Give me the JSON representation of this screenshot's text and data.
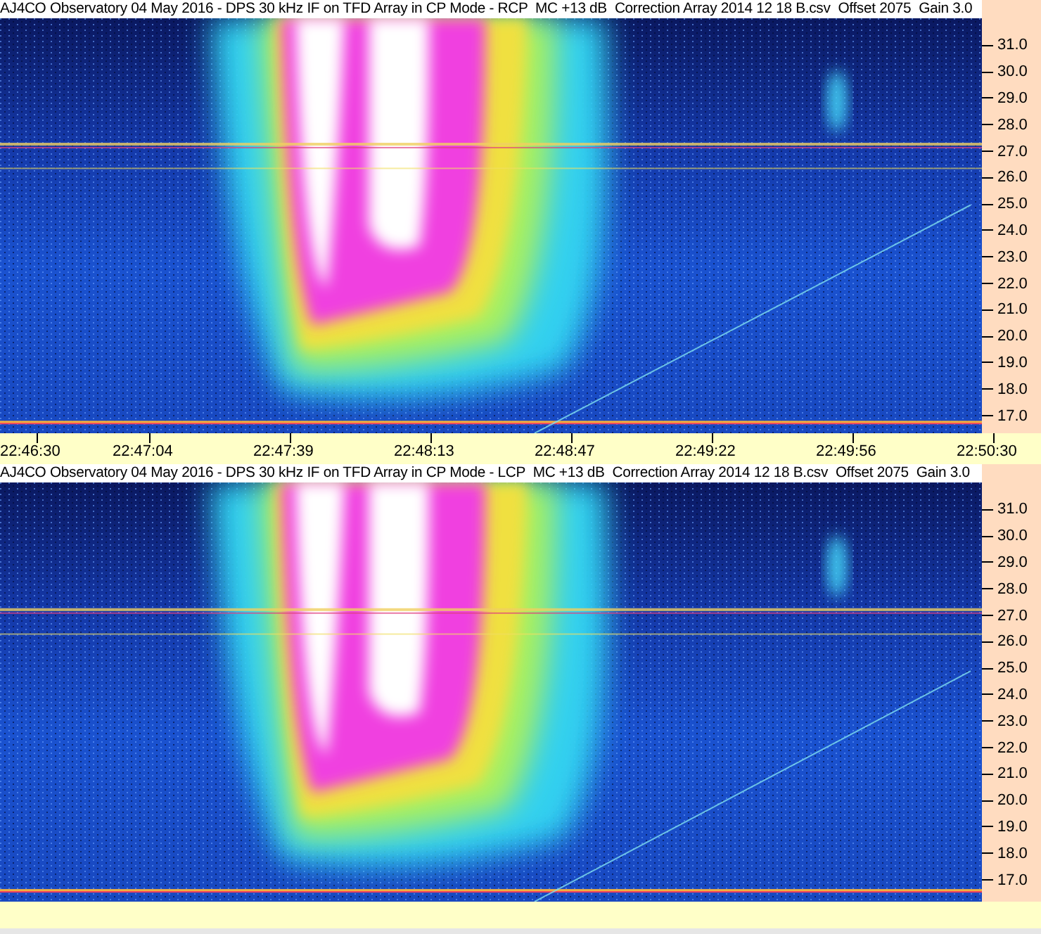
{
  "panels": [
    {
      "title": "AJ4CO Observatory 04 May 2016 - DPS 30 kHz IF on TFD Array in CP Mode - RCP  MC +13 dB  Correction Array 2014 12 18 B.csv  Offset 2075  Gain 3.0",
      "freq_ticks": [
        "31.0",
        "30.0",
        "29.0",
        "28.0",
        "27.0",
        "26.0",
        "25.0",
        "24.0",
        "23.0",
        "22.0",
        "21.0",
        "20.0",
        "19.0",
        "18.0",
        "17.0"
      ],
      "time_ticks": [
        "22:46:30",
        "22:47:04",
        "22:47:39",
        "22:48:13",
        "22:48:47",
        "22:49:22",
        "22:49:56",
        "22:50:30"
      ]
    },
    {
      "title": "AJ4CO Observatory 04 May 2016 - DPS 30 kHz IF on TFD Array in CP Mode - LCP  MC +13 dB  Correction Array 2014 12 18 B.csv  Offset 2075  Gain 3.0",
      "freq_ticks": [
        "31.0",
        "30.0",
        "29.0",
        "28.0",
        "27.0",
        "26.0",
        "25.0",
        "24.0",
        "23.0",
        "22.0",
        "21.0",
        "20.0",
        "19.0",
        "18.0",
        "17.0"
      ]
    }
  ]
}
